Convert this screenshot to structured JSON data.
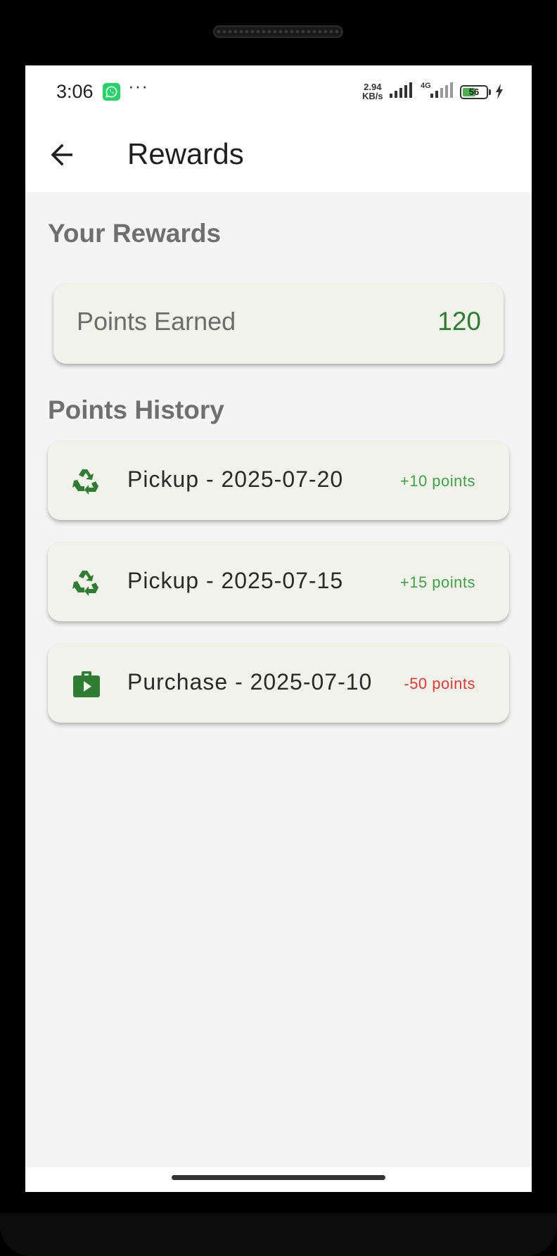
{
  "status_bar": {
    "time": "3:06",
    "net_speed_value": "2.94",
    "net_speed_unit": "KB/s",
    "network_type": "4G",
    "battery_level": "56",
    "battery_fraction": 0.56,
    "icons": [
      "whatsapp-icon",
      "more-dots-icon",
      "signal-icon",
      "battery-icon",
      "charging-bolt-icon"
    ]
  },
  "app_bar": {
    "title": "Rewards",
    "back_icon": "arrow-left-icon"
  },
  "rewards": {
    "heading": "Your Rewards",
    "points_label": "Points Earned",
    "points_value": "120"
  },
  "history": {
    "heading": "Points History",
    "items": [
      {
        "label": "Pickup - 2025-07-20",
        "points": "+10 points",
        "icon": "recycle-icon",
        "color": "#43a047"
      },
      {
        "label": "Pickup - 2025-07-15",
        "points": "+15 points",
        "icon": "recycle-icon",
        "color": "#43a047"
      },
      {
        "label": "Purchase - 2025-07-10",
        "points": "-50 points",
        "icon": "shop-bag-icon",
        "color": "#e53935"
      }
    ]
  },
  "colors": {
    "accent_green": "#2e7d32",
    "positive": "#43a047",
    "negative": "#e53935",
    "card_bg": "#f1f3ea",
    "page_bg": "#f4f4f4"
  }
}
